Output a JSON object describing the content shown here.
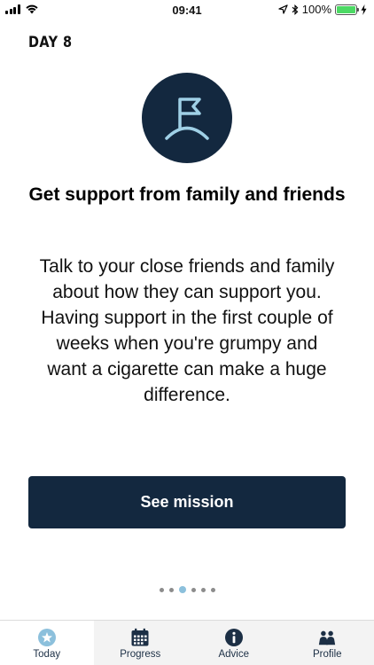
{
  "status_bar": {
    "time": "09:41",
    "battery_percent_label": "100%",
    "battery_level": 1.0
  },
  "day_label": "DAY 8",
  "mission": {
    "icon": "flag-on-hill-icon",
    "title": "Get support from family and friends",
    "body": "Talk to your close friends and family about how they can support you. Having support in the first couple of weeks when you're grumpy and want a cigarette can make a huge difference.",
    "button_label": "See mission"
  },
  "pagination": {
    "count": 6,
    "active_index": 2
  },
  "colors": {
    "primary": "#13283f",
    "dot_active": "#8cc0dc",
    "dot_inactive": "#8c8c8c",
    "battery": "#4cd964"
  },
  "tabs": [
    {
      "label": "Today",
      "icon": "star-badge-icon",
      "active": true
    },
    {
      "label": "Progress",
      "icon": "calendar-icon",
      "active": false
    },
    {
      "label": "Advice",
      "icon": "info-icon",
      "active": false
    },
    {
      "label": "Profile",
      "icon": "people-icon",
      "active": false
    }
  ]
}
